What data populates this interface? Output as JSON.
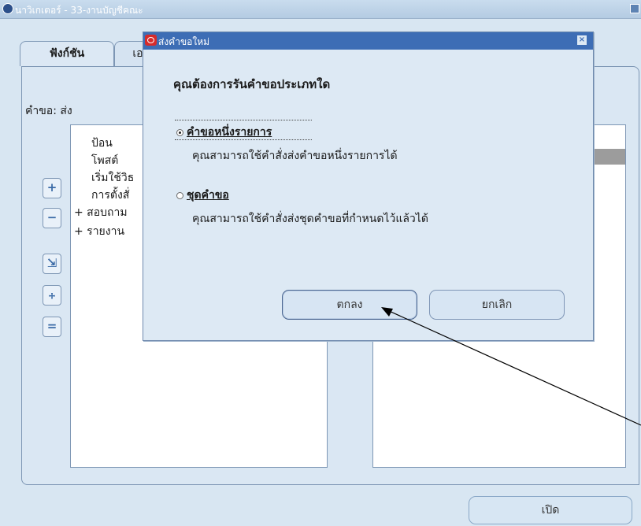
{
  "navigator": {
    "title": "นาวิเกเตอร์ - 33-งานบัญชีคณะ",
    "tabs": [
      {
        "label": "ฟังก์ชัน"
      },
      {
        "label": "เอ"
      }
    ],
    "request_label": "คำขอ: ส่ง",
    "tree_items": [
      {
        "label": "ป้อน"
      },
      {
        "label": "โพสต์"
      },
      {
        "label": "เริ่มใช้วิธ"
      },
      {
        "label": "การตั้งสั่"
      },
      {
        "label": "+  สอบถาม"
      },
      {
        "label": "+  รายงาน"
      }
    ],
    "side_buttons": [
      {
        "icon": "plus-icon",
        "glyph": "+"
      },
      {
        "icon": "minus-icon",
        "glyph": "−"
      },
      {
        "icon": "expand-branch-icon",
        "glyph": "⇲"
      },
      {
        "icon": "expand-all-icon",
        "glyph": "⧾"
      },
      {
        "icon": "collapse-all-icon",
        "glyph": "="
      }
    ],
    "open_button": "เปิด"
  },
  "dialog": {
    "title": "ส่งคำขอใหม่",
    "question": "คุณต้องการรันคำขอประเภทใด",
    "options": [
      {
        "label": "คำขอหนึ่งรายการ",
        "description": "คุณสามารถใช้คำสั่งส่งคำขอหนึ่งรายการได้",
        "selected": true
      },
      {
        "label": "ชุดคำขอ",
        "description": "คุณสามารถใช้คำสั่งส่งชุดคำขอที่กำหนดไว้แล้วได้",
        "selected": false
      }
    ],
    "ok_button": "ตกลง",
    "cancel_button": "ยกเลิก"
  },
  "colors": {
    "dialog_title_bar": "#3d6db5",
    "window_background": "#dae7f3",
    "selection_bar": "#9c9c9c"
  }
}
